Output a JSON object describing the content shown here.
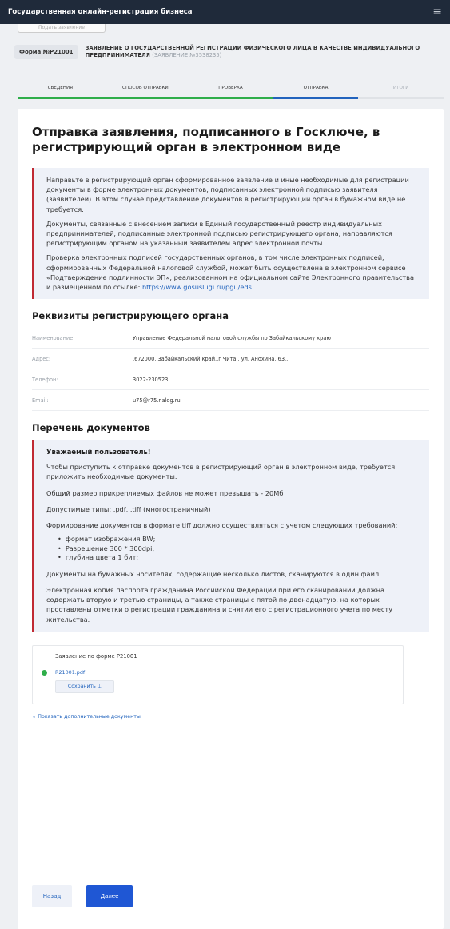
{
  "topbar": {
    "title": "Государственная онлайн-регистрация бизнеса",
    "menu_icon": "hamburger-menu-icon"
  },
  "hidden_button": {
    "label": "Подать заявление"
  },
  "form": {
    "badge": "Форма №Р21001",
    "title": "ЗАЯВЛЕНИЕ О ГОСУДАРСТВЕННОЙ РЕГИСТРАЦИИ ФИЗИЧЕСКОГО ЛИЦА В КАЧЕСТВЕ ИНДИВИДУАЛЬНОГО ПРЕДПРИНИМАТЕЛЯ",
    "number": "(ЗАЯВЛЕНИЕ №3538235)"
  },
  "steps": [
    {
      "label": "СВЕДЕНИЯ",
      "state": "done"
    },
    {
      "label": "СПОСОБ ОТПРАВКИ",
      "state": "done"
    },
    {
      "label": "ПРОВЕРКА",
      "state": "done"
    },
    {
      "label": "ОТПРАВКА",
      "state": "current"
    },
    {
      "label": "ИТОГИ",
      "state": "future"
    }
  ],
  "main": {
    "title": "Отправка заявления, подписанного в Госключе, в регистрирующий орган в электронном виде",
    "notice": {
      "p1": "Направьте в регистрирующий орган сформированное заявление и иные необходимые для регистрации документы в форме электронных документов, подписанных электронной подписью заявителя (заявителей). В этом случае представление документов в регистрирующий орган в бумажном виде не требуется.",
      "p2": "Документы, связанные с внесением записи в Единый государственный реестр индивидуальных предпринимателей, подписанные электронной подписью регистрирующего органа, направляются регистрирующим органом на указанный заявителем адрес электронной почты.",
      "p3": "Проверка электронных подписей государственных органов, в том числе электронных подписей, сформированных Федеральной налоговой службой, может быть осуществлена в электронном сервисе «Подтверждение подлинности ЭП», реализованном на официальном сайте Электронного правительства и размещенном по ссылке:",
      "link": "https://www.gosuslugi.ru/pgu/eds"
    }
  },
  "requisites": {
    "title": "Реквизиты регистрирующего органа",
    "rows": [
      {
        "label": "Наименование:",
        "value": "Управление Федеральной налоговой службы по Забайкальскому краю"
      },
      {
        "label": "Адрес:",
        "value": ",672000, Забайкальский край,,г Чита,, ул. Анохина, 63,,"
      },
      {
        "label": "Телефон:",
        "value": "3022-230523"
      },
      {
        "label": "Email:",
        "value": "u75@r75.nalog.ru"
      }
    ]
  },
  "documents": {
    "title": "Перечень документов",
    "greeting": "Уважаемый пользователь!",
    "p1": "Чтобы приступить к отправке документов в регистрирующий орган в электронном виде, требуется приложить необходимые документы.",
    "p2": "Общий размер прикрепляемых файлов не может превышать - 20Мб",
    "p3": "Допустимые типы: .pdf, .tiff (многостраничный)",
    "p4": "Формирование документов в формате tiff должно осуществляться с учетом следующих требований:",
    "bullets": [
      "формат изображения BW;",
      "Разрешение 300 * 300dpi;",
      "глубина цвета 1 бит;"
    ],
    "p5": "Документы на бумажных носителях, содержащие несколько листов, сканируются в один файл.",
    "p6": "Электронная копия паспорта гражданина Российской Федерации при его сканировании должна содержать вторую и третью страницы, а также страницы с пятой по двенадцатую, на которых проставлены отметки о регистрации гражданина и снятии его с регистрационного учета по месту жительства."
  },
  "attachment": {
    "title": "Заявление по форме Р21001",
    "file": "R21001.pdf",
    "save_label": "Сохранить ⊥"
  },
  "more_docs": "Показать дополнительные документы",
  "footer": {
    "back": "Назад",
    "next": "Далее"
  }
}
